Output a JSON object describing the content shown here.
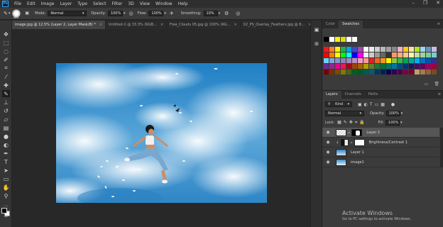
{
  "app": {
    "logo": "Ps"
  },
  "menu": [
    "File",
    "Edit",
    "Image",
    "Layer",
    "Type",
    "Select",
    "Filter",
    "3D",
    "View",
    "Window",
    "Help"
  ],
  "window_controls": [
    "–",
    "❐",
    "✕"
  ],
  "options": {
    "brush_size": "300",
    "mode_label": "Mode:",
    "mode_value": "Normal",
    "opacity_label": "Opacity:",
    "opacity_value": "100%",
    "flow_label": "Flow:",
    "flow_value": "100%",
    "smoothing_label": "Smoothing:",
    "smoothing_value": "10%"
  },
  "tabs": [
    {
      "label": "image.jpg @ 12.5% (Layer 2, Layer Mask/8) *",
      "active": true
    },
    {
      "label": "Untitled-1 @ 33.3% (RGB...",
      "active": false
    },
    {
      "label": "Free_Clouds 05.jpg @ 100% (RG...",
      "active": false
    },
    {
      "label": "02_PS_Overlay_Feathers.jpg @ 8...",
      "active": false
    }
  ],
  "tab_close": "×",
  "color_panel": {
    "tabs": [
      "Color",
      "Swatches"
    ],
    "active_tab": "Swatches",
    "top_swatches": [
      "#000000",
      "#ffffff",
      "#fff200",
      "#d7e000",
      "#ffffff",
      "#ffffff"
    ],
    "grid_colors": [
      "#ed1c24",
      "#ff7f27",
      "#fff200",
      "#22b14c",
      "#00a2e8",
      "#3f48cc",
      "#a349a4",
      "#ffffff",
      "#e8e8e8",
      "#d0d0d0",
      "#b8b8b8",
      "#a0a0a0",
      "#888888",
      "#ffaec9",
      "#ffc90e",
      "#efe4b0",
      "#b5e61d",
      "#99d9ea",
      "#7092be",
      "#c8bfe7",
      "#ff0000",
      "#ff8000",
      "#ffff00",
      "#00ff00",
      "#00ffff",
      "#0000ff",
      "#ff00ff",
      "#f0f0f0",
      "#cccccc",
      "#999999",
      "#666666",
      "#333333",
      "#f7977a",
      "#f9ad81",
      "#fdc68a",
      "#fff79a",
      "#c4df9b",
      "#a3d39c",
      "#82ca9d",
      "#7bcdc8",
      "#6ecff6",
      "#7ea7d8",
      "#8493ca",
      "#8882be",
      "#a187be",
      "#bc8dbf",
      "#f49ac2",
      "#f6989d",
      "#ed1c24",
      "#f26522",
      "#f7941d",
      "#fff200",
      "#8dc73f",
      "#39b54a",
      "#00a651",
      "#00a99d",
      "#00aeef",
      "#0072bc",
      "#0054a6",
      "#2e3192",
      "#662d91",
      "#92278f",
      "#ec008c",
      "#ed145b",
      "#9e0b0f",
      "#a0410d",
      "#a36209",
      "#aba000",
      "#598527",
      "#1a7b30",
      "#007236",
      "#00746b",
      "#0076a3",
      "#004b80",
      "#003471",
      "#1b1464",
      "#440e62",
      "#630460",
      "#9e005d",
      "#9e0039",
      "#790000",
      "#7b2e00",
      "#7d4900",
      "#827b00",
      "#406618",
      "#005e20",
      "#005826",
      "#005952",
      "#005b7f",
      "#003663",
      "#002157",
      "#0d004c",
      "#32004b",
      "#4b0049",
      "#7b0046",
      "#7a0026",
      "#c69c6d",
      "#a67c52",
      "#8c6239",
      "#754c24"
    ],
    "foot_icons": [
      "▭",
      "🗑"
    ]
  },
  "layers_panel": {
    "tabs": [
      "Layers",
      "Channels",
      "Paths"
    ],
    "active_tab": "Layers",
    "kind_label": "Kind",
    "blend_mode": "Normal",
    "opacity_label": "Opacity:",
    "opacity_value": "100%",
    "lock_label": "Lock:",
    "fill_label": "Fill:",
    "fill_value": "100%",
    "layers": [
      {
        "name": "Layer 2",
        "selected": true
      },
      {
        "name": "Brightness/Contrast 1",
        "selected": false
      },
      {
        "name": "Layer 1",
        "selected": false
      },
      {
        "name": "image1",
        "selected": false
      }
    ]
  },
  "watermark": {
    "title": "Activate Windows",
    "subtitle": "Go to PC settings to activate Windows."
  },
  "tools": [
    "move-tool-icon",
    "marquee-tool-icon",
    "lasso-tool-icon",
    "quick-select-tool-icon",
    "crop-tool-icon",
    "eyedropper-tool-icon",
    "healing-tool-icon",
    "brush-tool-icon",
    "clone-stamp-tool-icon",
    "history-brush-tool-icon",
    "eraser-tool-icon",
    "gradient-tool-icon",
    "blur-tool-icon",
    "dodge-tool-icon",
    "pen-tool-icon",
    "type-tool-icon",
    "path-select-tool-icon",
    "rectangle-tool-icon",
    "hand-tool-icon",
    "zoom-tool-icon"
  ]
}
